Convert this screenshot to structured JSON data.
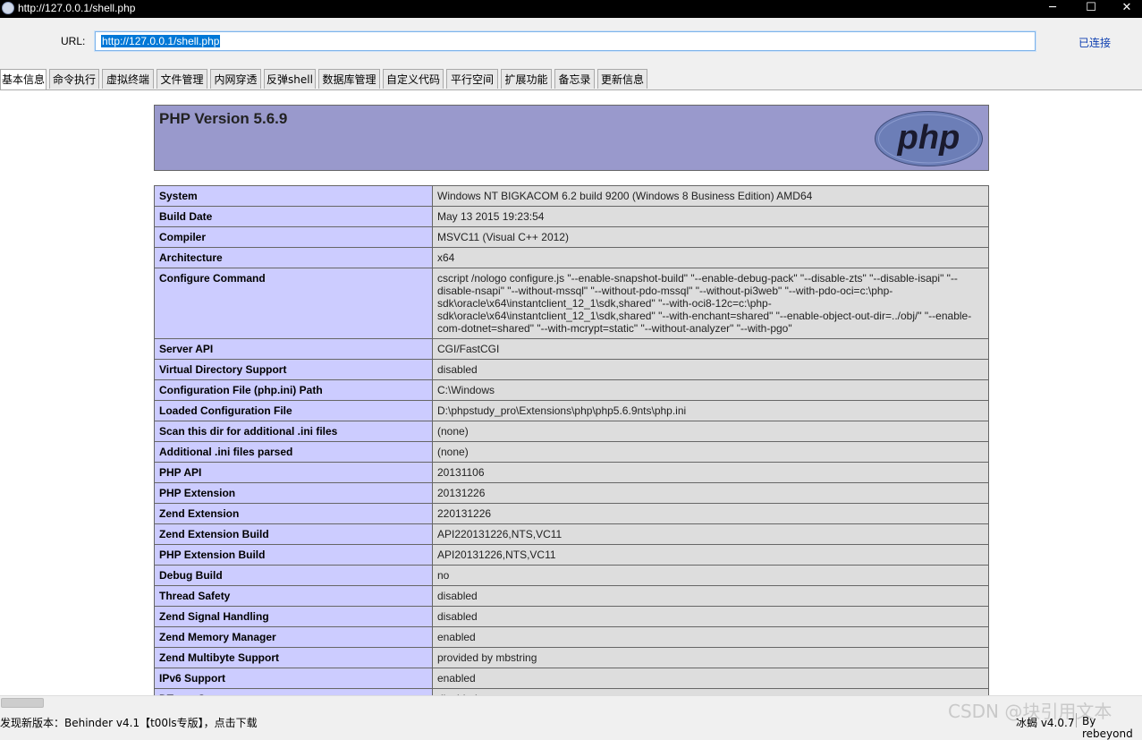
{
  "window": {
    "title": "http://127.0.0.1/shell.php"
  },
  "urlbar": {
    "label": "URL:",
    "value": "http://127.0.0.1/shell.php",
    "status": "已连接"
  },
  "tabs": [
    "基本信息",
    "命令执行",
    "虚拟终端",
    "文件管理",
    "内网穿透",
    "反弹shell",
    "数据库管理",
    "自定义代码",
    "平行空间",
    "扩展功能",
    "备忘录",
    "更新信息"
  ],
  "phpinfo": {
    "header_title": "PHP Version 5.6.9",
    "logo_text": "php",
    "rows": [
      {
        "key": "System",
        "value": "Windows NT BIGKACOM 6.2 build 9200 (Windows 8 Business Edition) AMD64"
      },
      {
        "key": "Build Date",
        "value": "May 13 2015 19:23:54"
      },
      {
        "key": "Compiler",
        "value": "MSVC11 (Visual C++ 2012)"
      },
      {
        "key": "Architecture",
        "value": "x64"
      },
      {
        "key": "Configure Command",
        "value": "cscript /nologo configure.js \"--enable-snapshot-build\" \"--enable-debug-pack\" \"--disable-zts\" \"--disable-isapi\" \"--disable-nsapi\" \"--without-mssql\" \"--without-pdo-mssql\" \"--without-pi3web\" \"--with-pdo-oci=c:\\php-sdk\\oracle\\x64\\instantclient_12_1\\sdk,shared\" \"--with-oci8-12c=c:\\php-sdk\\oracle\\x64\\instantclient_12_1\\sdk,shared\" \"--with-enchant=shared\" \"--enable-object-out-dir=../obj/\" \"--enable-com-dotnet=shared\" \"--with-mcrypt=static\" \"--without-analyzer\" \"--with-pgo\""
      },
      {
        "key": "Server API",
        "value": "CGI/FastCGI"
      },
      {
        "key": "Virtual Directory Support",
        "value": "disabled"
      },
      {
        "key": "Configuration File (php.ini) Path",
        "value": "C:\\Windows"
      },
      {
        "key": "Loaded Configuration File",
        "value": "D:\\phpstudy_pro\\Extensions\\php\\php5.6.9nts\\php.ini"
      },
      {
        "key": "Scan this dir for additional .ini files",
        "value": "(none)"
      },
      {
        "key": "Additional .ini files parsed",
        "value": "(none)"
      },
      {
        "key": "PHP API",
        "value": "20131106"
      },
      {
        "key": "PHP Extension",
        "value": "20131226"
      },
      {
        "key": "Zend Extension",
        "value": "220131226"
      },
      {
        "key": "Zend Extension Build",
        "value": "API220131226,NTS,VC11"
      },
      {
        "key": "PHP Extension Build",
        "value": "API20131226,NTS,VC11"
      },
      {
        "key": "Debug Build",
        "value": "no"
      },
      {
        "key": "Thread Safety",
        "value": "disabled"
      },
      {
        "key": "Zend Signal Handling",
        "value": "disabled"
      },
      {
        "key": "Zend Memory Manager",
        "value": "enabled"
      },
      {
        "key": "Zend Multibyte Support",
        "value": "provided by mbstring"
      },
      {
        "key": "IPv6 Support",
        "value": "enabled"
      },
      {
        "key": "DTrace Support",
        "value": "disabled"
      }
    ]
  },
  "statusbar": {
    "message": "发现新版本：Behinder v4.1【t00ls专版】，点击下载",
    "version": "冰蝎 v4.0.7",
    "author": "By rebeyond"
  },
  "watermark": "CSDN @块引用文本"
}
